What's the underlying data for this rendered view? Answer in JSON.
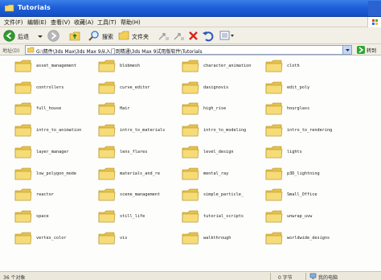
{
  "window": {
    "title": "Tutorials"
  },
  "menu": [
    "文件(F)",
    "编辑(E)",
    "查看(V)",
    "收藏(A)",
    "工具(T)",
    "帮助(H)"
  ],
  "toolbar": {
    "back_label": "后退",
    "search_label": "搜索",
    "folders_label": "文件夹"
  },
  "address": {
    "label": "地址(D)",
    "value": "G:\\精件\\3ds Max\\3ds Max 9从入门到精通\\3ds Max 9试用版软件\\Tutorials",
    "go_label": "转到"
  },
  "folders": [
    "asset_management",
    "blobmesh",
    "character_animation",
    "cloth",
    "controllers",
    "curve_editor",
    "dasignovis",
    "edit_poly",
    "full_house",
    "Hair",
    "high_rise",
    "hourglass",
    "intro_to_animation",
    "intro_to_materials",
    "intro_to_modeling",
    "intro_to_rendering",
    "layer_manager",
    "lens_flares",
    "level_design",
    "lights",
    "low_polygon_mode",
    "materials_and_re",
    "mental_ray",
    "p3D_lightning",
    "reactor",
    "scene_management",
    "simple_particle_",
    "Small_Office",
    "space",
    "still_life",
    "tutorial_scripts",
    "unwrap_uvw",
    "vertex_color",
    "vis",
    "walkthrough",
    "worldwide_designs"
  ],
  "status": {
    "objects": "36 个对象",
    "size": "0 字节",
    "location": "我的电脑"
  },
  "colors": {
    "titlebar": "#1f5fd8",
    "folder": "#f2d56b",
    "content_bg": "#fdfdfb"
  }
}
